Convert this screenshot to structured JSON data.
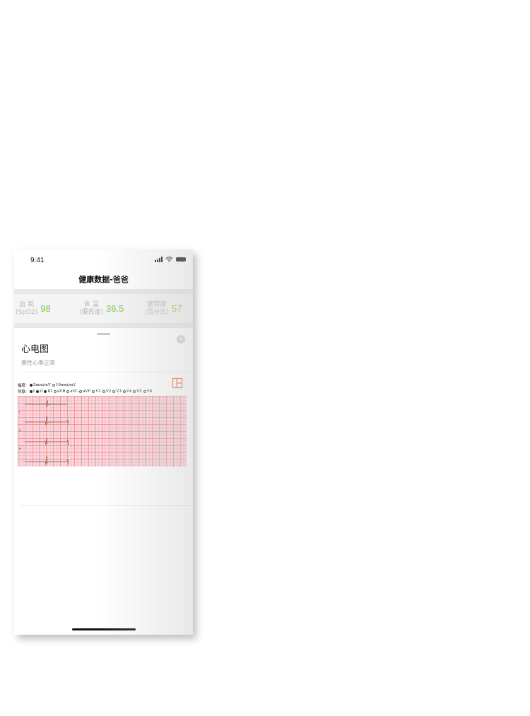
{
  "status_bar": {
    "time": "9:41"
  },
  "nav": {
    "title": "健康数据-爸爸"
  },
  "stats": [
    {
      "label_line1": "血 氧",
      "label_line2": "(SpO2)",
      "value": "98",
      "color": "#7ac943"
    },
    {
      "label_line1": "体 温",
      "label_line2": "(摄氏度)",
      "value": "36.5",
      "color": "#7ac943"
    },
    {
      "label_line1": "疲劳度",
      "label_line2": "(百分比)",
      "value": "57",
      "color": "#e5a82e"
    }
  ],
  "sheet": {
    "title": "心电图",
    "subtitle": "窦性心率正常",
    "close_icon": "close-icon",
    "expand_icon": "expand-icon"
  },
  "ecg": {
    "amplitude_label": "幅度:",
    "amplitude_options": [
      {
        "label": "5mm/mV",
        "selected": true
      },
      {
        "label": "10mm/mV",
        "selected": false
      }
    ],
    "lead_label": "导联:",
    "lead_options": [
      {
        "label": "I",
        "selected": true
      },
      {
        "label": "II",
        "selected": true
      },
      {
        "label": "III",
        "selected": true
      },
      {
        "label": "aVR",
        "selected": false
      },
      {
        "label": "aVL",
        "selected": false
      },
      {
        "label": "aVF",
        "selected": false
      },
      {
        "label": "V1",
        "selected": false
      },
      {
        "label": "V2",
        "selected": false
      },
      {
        "label": "V3",
        "selected": false
      },
      {
        "label": "V4",
        "selected": false
      },
      {
        "label": "V5",
        "selected": false
      },
      {
        "label": "V6",
        "selected": false
      }
    ],
    "trace_color": "#8a5a3a",
    "grid_color": "#fbe1e4"
  }
}
